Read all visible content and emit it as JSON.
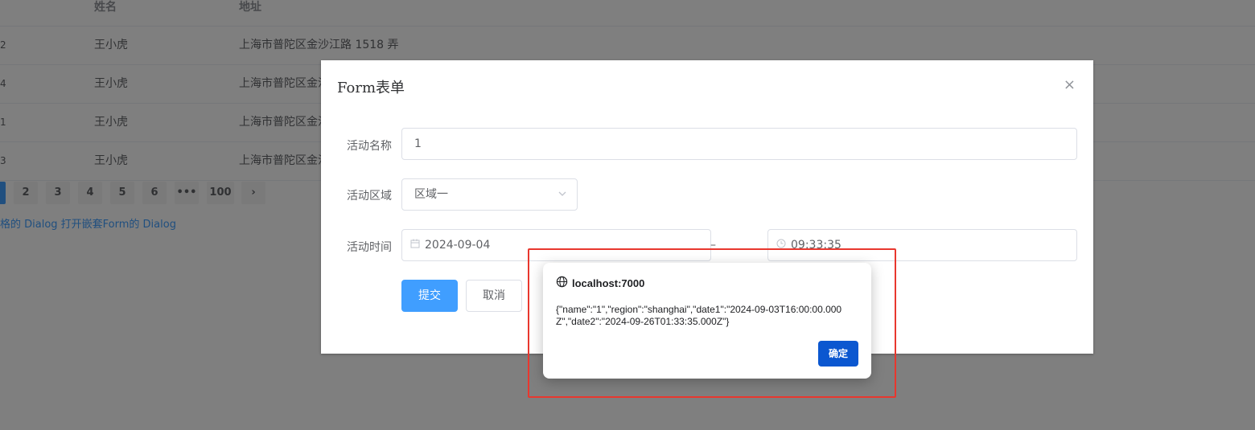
{
  "table": {
    "headers": {
      "name": "姓名",
      "address": "地址"
    },
    "rows": [
      {
        "id": "2",
        "name": "王小虎",
        "address": "上海市普陀区金沙江路 1518 弄"
      },
      {
        "id": "4",
        "name": "王小虎",
        "address": "上海市普陀区金沙"
      },
      {
        "id": "1",
        "name": "王小虎",
        "address": "上海市普陀区金沙"
      },
      {
        "id": "3",
        "name": "王小虎",
        "address": "上海市普陀区金沙"
      }
    ]
  },
  "pagination": {
    "pages": [
      "2",
      "3",
      "4",
      "5",
      "6"
    ],
    "ellipsis": "•••",
    "last": "100",
    "next": "›"
  },
  "links": {
    "nested_dialog": "格的 Dialog 打开嵌套Form的 Dialog"
  },
  "form_dialog": {
    "title": "Form表单",
    "close": "×",
    "fields": {
      "name_label": "活动名称",
      "name_value": "1",
      "region_label": "活动区域",
      "region_value": "区域一",
      "time_label": "活动时间",
      "date_value": "2024-09-04",
      "separator": "–",
      "time_value": "09:33:35"
    },
    "buttons": {
      "submit": "提交",
      "cancel": "取消"
    }
  },
  "alert": {
    "origin": "localhost:7000",
    "message": "{\"name\":\"1\",\"region\":\"shanghai\",\"date1\":\"2024-09-03T16:00:00.000Z\",\"date2\":\"2024-09-26T01:33:35.000Z\"}",
    "ok": "确定"
  },
  "colors": {
    "primary": "#409eff",
    "alert_button": "#0b57d0",
    "highlight": "#e8372e"
  }
}
